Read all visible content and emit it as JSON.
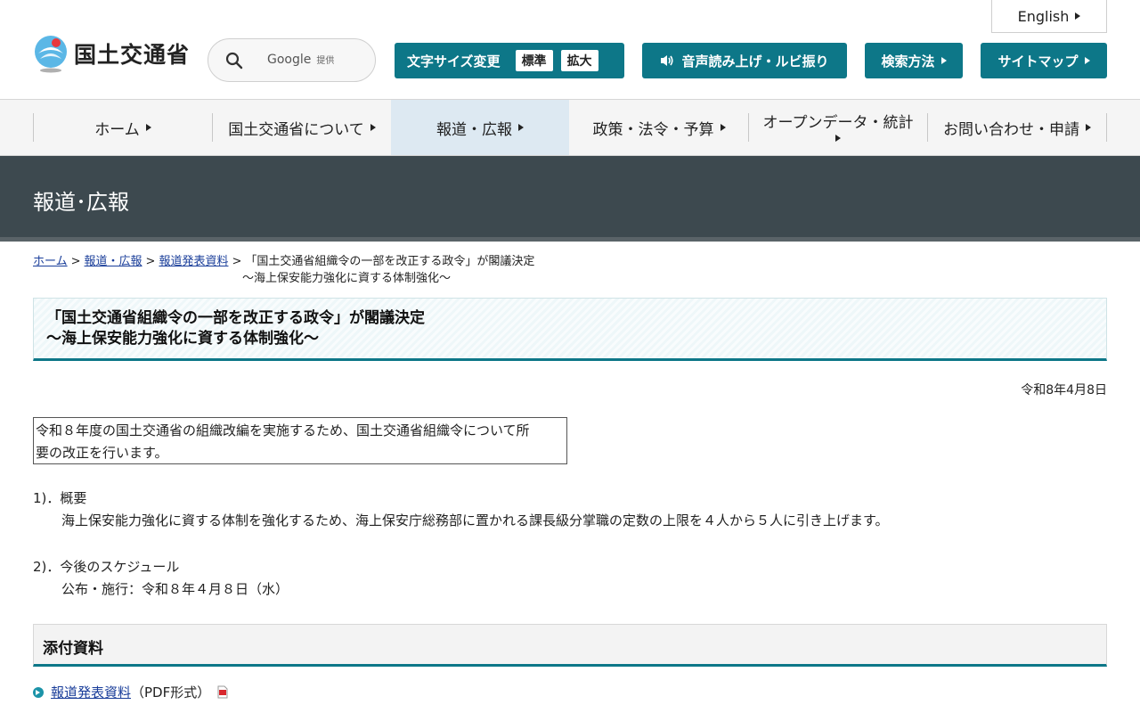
{
  "header": {
    "logo_text": "国土交通省",
    "search": {
      "brand": "Google",
      "provided": "提供"
    },
    "english_label": "English",
    "fontsize": {
      "label": "文字サイズ変更",
      "standard": "標準",
      "large": "拡大"
    },
    "voice_label": "音声読み上げ・ルビ振り",
    "howto_label": "検索方法",
    "sitemap_label": "サイトマップ"
  },
  "nav": {
    "items": [
      {
        "label": "ホーム"
      },
      {
        "label": "国土交通省について"
      },
      {
        "label": "報道・広報"
      },
      {
        "label": "政策・法令・予算"
      },
      {
        "label": "オープンデータ・統計"
      },
      {
        "label": "お問い合わせ・申請"
      }
    ]
  },
  "banner": {
    "title": "報道･広報"
  },
  "breadcrumb": {
    "home": "ホーム",
    "level1": "報道・広報",
    "level2": "報道発表資料",
    "current_line1": "「国土交通省組織令の一部を改正する政令」が閣議決定",
    "current_line2": "～海上保安能力強化に資する体制強化～",
    "separator": ">"
  },
  "article": {
    "title_line1": "「国土交通省組織令の一部を改正する政令」が閣議決定",
    "title_line2": "～海上保安能力強化に資する体制強化～",
    "date": "令和8年4月8日",
    "lead_line1": "令和８年度の国土交通省の組織改編を実施するため、国土交通省組織令について所",
    "lead_line2": "要の改正を行います。",
    "sections": [
      {
        "heading": "1)．概要",
        "body": "海上保安能力強化に資する体制を強化するため、海上保安庁総務部に置かれる課長級分掌職の定数の上限を４人から５人に引き上げます。"
      },
      {
        "heading": "2)．今後のスケジュール",
        "body": "公布・施行：令和８年４月８日（水）"
      }
    ],
    "attachments_heading": "添付資料",
    "attachment": {
      "link": "報道発表資料",
      "format": "（PDF形式）"
    }
  },
  "colors": {
    "teal": "#0d7788",
    "banner": "#3d494f",
    "nav_active": "#dde9f2"
  }
}
